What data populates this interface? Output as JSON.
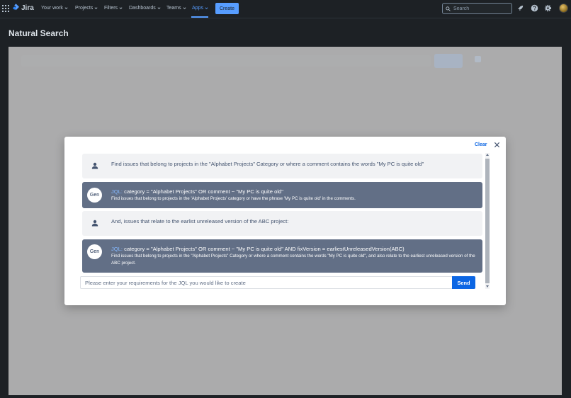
{
  "topnav": {
    "logo_text": "Jira",
    "items": [
      {
        "label": "Your work"
      },
      {
        "label": "Projects"
      },
      {
        "label": "Filters"
      },
      {
        "label": "Dashboards"
      },
      {
        "label": "Teams"
      },
      {
        "label": "Apps"
      }
    ],
    "active_item": "Apps",
    "create_label": "Create",
    "search_placeholder": "Search",
    "icons": [
      "app-switcher-icon",
      "rocket-icon",
      "help-icon",
      "settings-icon"
    ]
  },
  "page": {
    "title": "Natural Search"
  },
  "modal": {
    "clear_label": "Clear",
    "messages": [
      {
        "role": "user",
        "text": "Find issues that belong to projects in the \"Alphabet Projects\" Category or where a comment contains the words \"My PC is quite old\""
      },
      {
        "role": "gen",
        "badge": "Gen",
        "jql_prefix": "JQL:",
        "jql": "category = \"Alphabet Projects\" OR comment ~ \"My PC is quite old\"",
        "description": "Find issues that belong to projects in the 'Alphabet Projects' category or have the phrase 'My PC is quite old' in the comments."
      },
      {
        "role": "user",
        "text": "And, issues that relate to the earlist unreleased version of the ABC project:"
      },
      {
        "role": "gen",
        "badge": "Gen",
        "jql_prefix": "JQL:",
        "jql": "category = \"Alphabet Projects\" OR comment ~ \"My PC is quite old\" AND fixVersion = earliestUnreleasedVersion(ABC)",
        "description": "Find issues that belong to projects in the \"Alphabet Projects\" Category or where a comment contains the words \"My PC is quite old\", and also relate to the earliest unreleased version of the ABC project."
      }
    ],
    "input_placeholder": "Please enter your requirements for the JQL you would like to create",
    "input_value": "",
    "send_label": "Send"
  },
  "colors": {
    "accent": "#579dff",
    "primary_button": "#0c66e4",
    "gen_bubble": "#626f86",
    "user_bubble": "#f1f2f4"
  }
}
